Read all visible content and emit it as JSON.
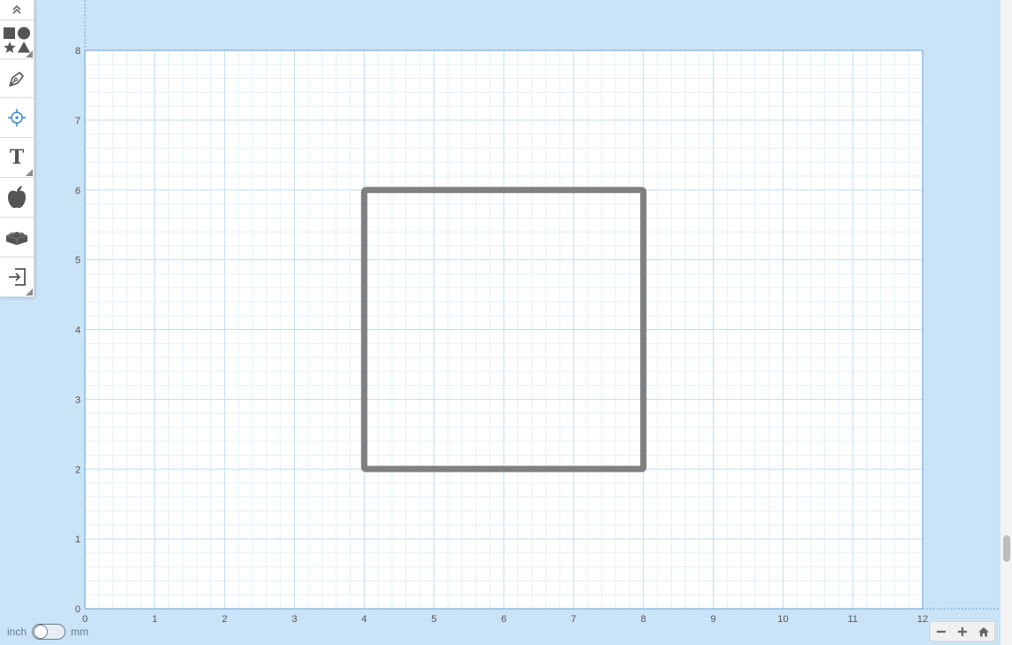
{
  "canvas": {
    "units": "inch",
    "x_range": [
      0,
      12
    ],
    "y_range": [
      0,
      8
    ],
    "major_step": 1,
    "minor_divisions": 5,
    "x_ticks": [
      "0",
      "1",
      "2",
      "3",
      "4",
      "5",
      "6",
      "7",
      "8",
      "9",
      "10",
      "11",
      "12"
    ],
    "y_ticks": [
      "0",
      "1",
      "2",
      "3",
      "4",
      "5",
      "6",
      "7",
      "8"
    ],
    "colors": {
      "workspace": "#c9e3f7",
      "sheet": "#ffffff",
      "minor_grid": "#e3f0fa",
      "major_grid": "#c2ddf1",
      "sheet_border": "#6aa3d4",
      "tick_label": "#555555"
    }
  },
  "shapes": [
    {
      "type": "rectangle",
      "x": 4,
      "y": 2,
      "width": 4,
      "height": 4,
      "stroke": "#808080",
      "stroke_units": 0.09,
      "fill": "none"
    }
  ],
  "toolbar": {
    "tools": [
      {
        "name": "collapse-toolbar",
        "icon": "double-chevron-up-icon"
      },
      {
        "name": "basic-shapes",
        "icon": "shapes-icon"
      },
      {
        "name": "pen-tool",
        "icon": "pen-nib-icon"
      },
      {
        "name": "point-tool",
        "icon": "target-icon"
      },
      {
        "name": "text-tool",
        "icon": "text-t-icon",
        "label": "T"
      },
      {
        "name": "icons-library",
        "icon": "apple-icon"
      },
      {
        "name": "brick-library",
        "icon": "brick-icon"
      },
      {
        "name": "import-tool",
        "icon": "import-icon"
      }
    ]
  },
  "unit_toggle": {
    "left_label": "inch",
    "right_label": "mm",
    "selected": "inch"
  },
  "zoom": {
    "zoom_out_icon": "minus-icon",
    "zoom_in_icon": "plus-icon",
    "home_icon": "home-icon"
  }
}
